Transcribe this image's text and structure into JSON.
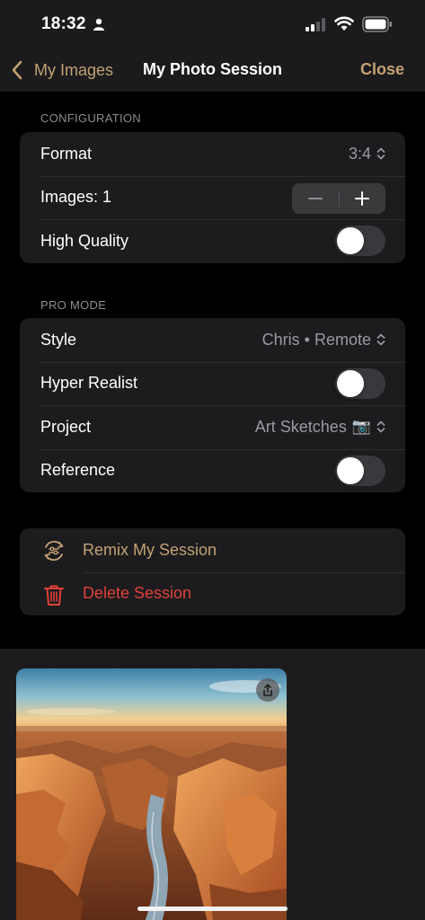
{
  "status_bar": {
    "time": "18:32"
  },
  "nav": {
    "back_label": "My Images",
    "title": "My Photo Session",
    "close_label": "Close"
  },
  "configuration": {
    "header": "CONFIGURATION",
    "format_label": "Format",
    "format_value": "3:4",
    "images_label": "Images: 1",
    "high_quality_label": "High Quality",
    "high_quality_on": false
  },
  "pro_mode": {
    "header": "PRO MODE",
    "style_label": "Style",
    "style_value": "Chris • Remote",
    "hyper_realist_label": "Hyper Realist",
    "hyper_realist_on": false,
    "project_label": "Project",
    "project_value": "Art Sketches",
    "project_emoji": "📷",
    "reference_label": "Reference",
    "reference_on": false
  },
  "actions": {
    "remix_label": "Remix My Session",
    "delete_label": "Delete Session"
  },
  "colors": {
    "accent": "#c2a173",
    "destructive": "#e0413a",
    "background": "#000000",
    "group_background": "#1c1c1e"
  },
  "icons": {
    "back": "chevron-left-icon",
    "updown": "chevron-updown-icon",
    "remix": "remix-icon",
    "delete": "trash-icon",
    "share": "share-icon"
  }
}
